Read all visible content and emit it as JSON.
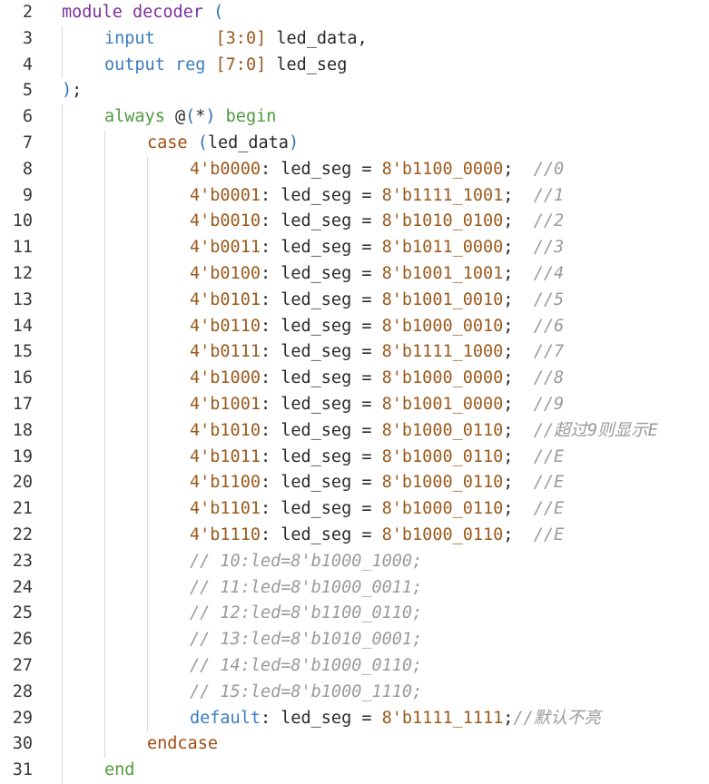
{
  "colors": {
    "background": "#ffffff",
    "line_number": "#3a3a3a",
    "module_keyword": "#7b2f9e",
    "port_keyword": "#3a7dbf",
    "always_keyword": "#4f9a3e",
    "control_keyword": "#a04a10",
    "number_literal": "#9a5a1d",
    "comment": "#9a9a9a",
    "indent_guide": "#d6d6d6"
  },
  "lines": [
    {
      "n": "2",
      "indent": 0,
      "tokens": [
        {
          "c": "kw",
          "t": "module"
        },
        {
          "c": "pl",
          "t": " "
        },
        {
          "c": "kw",
          "t": "decoder"
        },
        {
          "c": "pl",
          "t": " "
        },
        {
          "c": "br",
          "t": "("
        }
      ]
    },
    {
      "n": "3",
      "indent": 1,
      "tokens": [
        {
          "c": "kb",
          "t": "input"
        },
        {
          "c": "pl",
          "t": "      "
        },
        {
          "c": "num",
          "t": "[3:0]"
        },
        {
          "c": "pl",
          "t": " led_data,"
        }
      ]
    },
    {
      "n": "4",
      "indent": 1,
      "tokens": [
        {
          "c": "kb",
          "t": "output reg"
        },
        {
          "c": "pl",
          "t": " "
        },
        {
          "c": "num",
          "t": "[7:0]"
        },
        {
          "c": "pl",
          "t": " led_seg"
        }
      ]
    },
    {
      "n": "5",
      "indent": 0,
      "tokens": [
        {
          "c": "br",
          "t": ")"
        },
        {
          "c": "pl",
          "t": ";"
        }
      ]
    },
    {
      "n": "6",
      "indent": 1,
      "tokens": [
        {
          "c": "kg",
          "t": "always"
        },
        {
          "c": "pl",
          "t": " @"
        },
        {
          "c": "br",
          "t": "("
        },
        {
          "c": "pl",
          "t": "*"
        },
        {
          "c": "br",
          "t": ")"
        },
        {
          "c": "pl",
          "t": " "
        },
        {
          "c": "kg",
          "t": "begin"
        }
      ]
    },
    {
      "n": "7",
      "indent": 2,
      "tokens": [
        {
          "c": "kr",
          "t": "case"
        },
        {
          "c": "pl",
          "t": " "
        },
        {
          "c": "br",
          "t": "("
        },
        {
          "c": "pl",
          "t": "led_data"
        },
        {
          "c": "br",
          "t": ")"
        }
      ]
    },
    {
      "n": "8",
      "indent": 3,
      "tokens": [
        {
          "c": "num",
          "t": "4'b0000"
        },
        {
          "c": "pl",
          "t": ": led_seg = "
        },
        {
          "c": "num",
          "t": "8'b1100_0000"
        },
        {
          "c": "pl",
          "t": ";  "
        },
        {
          "c": "cm",
          "t": "//0"
        }
      ]
    },
    {
      "n": "9",
      "indent": 3,
      "tokens": [
        {
          "c": "num",
          "t": "4'b0001"
        },
        {
          "c": "pl",
          "t": ": led_seg = "
        },
        {
          "c": "num",
          "t": "8'b1111_1001"
        },
        {
          "c": "pl",
          "t": ";  "
        },
        {
          "c": "cm",
          "t": "//1"
        }
      ]
    },
    {
      "n": "10",
      "indent": 3,
      "tokens": [
        {
          "c": "num",
          "t": "4'b0010"
        },
        {
          "c": "pl",
          "t": ": led_seg = "
        },
        {
          "c": "num",
          "t": "8'b1010_0100"
        },
        {
          "c": "pl",
          "t": ";  "
        },
        {
          "c": "cm",
          "t": "//2"
        }
      ]
    },
    {
      "n": "11",
      "indent": 3,
      "tokens": [
        {
          "c": "num",
          "t": "4'b0011"
        },
        {
          "c": "pl",
          "t": ": led_seg = "
        },
        {
          "c": "num",
          "t": "8'b1011_0000"
        },
        {
          "c": "pl",
          "t": ";  "
        },
        {
          "c": "cm",
          "t": "//3"
        }
      ]
    },
    {
      "n": "12",
      "indent": 3,
      "tokens": [
        {
          "c": "num",
          "t": "4'b0100"
        },
        {
          "c": "pl",
          "t": ": led_seg = "
        },
        {
          "c": "num",
          "t": "8'b1001_1001"
        },
        {
          "c": "pl",
          "t": ";  "
        },
        {
          "c": "cm",
          "t": "//4"
        }
      ]
    },
    {
      "n": "13",
      "indent": 3,
      "tokens": [
        {
          "c": "num",
          "t": "4'b0101"
        },
        {
          "c": "pl",
          "t": ": led_seg = "
        },
        {
          "c": "num",
          "t": "8'b1001_0010"
        },
        {
          "c": "pl",
          "t": ";  "
        },
        {
          "c": "cm",
          "t": "//5"
        }
      ]
    },
    {
      "n": "14",
      "indent": 3,
      "tokens": [
        {
          "c": "num",
          "t": "4'b0110"
        },
        {
          "c": "pl",
          "t": ": led_seg = "
        },
        {
          "c": "num",
          "t": "8'b1000_0010"
        },
        {
          "c": "pl",
          "t": ";  "
        },
        {
          "c": "cm",
          "t": "//6"
        }
      ]
    },
    {
      "n": "15",
      "indent": 3,
      "tokens": [
        {
          "c": "num",
          "t": "4'b0111"
        },
        {
          "c": "pl",
          "t": ": led_seg = "
        },
        {
          "c": "num",
          "t": "8'b1111_1000"
        },
        {
          "c": "pl",
          "t": ";  "
        },
        {
          "c": "cm",
          "t": "//7"
        }
      ]
    },
    {
      "n": "16",
      "indent": 3,
      "tokens": [
        {
          "c": "num",
          "t": "4'b1000"
        },
        {
          "c": "pl",
          "t": ": led_seg = "
        },
        {
          "c": "num",
          "t": "8'b1000_0000"
        },
        {
          "c": "pl",
          "t": ";  "
        },
        {
          "c": "cm",
          "t": "//8"
        }
      ]
    },
    {
      "n": "17",
      "indent": 3,
      "tokens": [
        {
          "c": "num",
          "t": "4'b1001"
        },
        {
          "c": "pl",
          "t": ": led_seg = "
        },
        {
          "c": "num",
          "t": "8'b1001_0000"
        },
        {
          "c": "pl",
          "t": ";  "
        },
        {
          "c": "cm",
          "t": "//9"
        }
      ]
    },
    {
      "n": "18",
      "indent": 3,
      "tokens": [
        {
          "c": "num",
          "t": "4'b1010"
        },
        {
          "c": "pl",
          "t": ": led_seg = "
        },
        {
          "c": "num",
          "t": "8'b1000_0110"
        },
        {
          "c": "pl",
          "t": ";  "
        },
        {
          "c": "cm",
          "t": "//超过9则显示E"
        }
      ]
    },
    {
      "n": "19",
      "indent": 3,
      "tokens": [
        {
          "c": "num",
          "t": "4'b1011"
        },
        {
          "c": "pl",
          "t": ": led_seg = "
        },
        {
          "c": "num",
          "t": "8'b1000_0110"
        },
        {
          "c": "pl",
          "t": ";  "
        },
        {
          "c": "cm",
          "t": "//E"
        }
      ]
    },
    {
      "n": "20",
      "indent": 3,
      "tokens": [
        {
          "c": "num",
          "t": "4'b1100"
        },
        {
          "c": "pl",
          "t": ": led_seg = "
        },
        {
          "c": "num",
          "t": "8'b1000_0110"
        },
        {
          "c": "pl",
          "t": ";  "
        },
        {
          "c": "cm",
          "t": "//E"
        }
      ]
    },
    {
      "n": "21",
      "indent": 3,
      "tokens": [
        {
          "c": "num",
          "t": "4'b1101"
        },
        {
          "c": "pl",
          "t": ": led_seg = "
        },
        {
          "c": "num",
          "t": "8'b1000_0110"
        },
        {
          "c": "pl",
          "t": ";  "
        },
        {
          "c": "cm",
          "t": "//E"
        }
      ]
    },
    {
      "n": "22",
      "indent": 3,
      "tokens": [
        {
          "c": "num",
          "t": "4'b1110"
        },
        {
          "c": "pl",
          "t": ": led_seg = "
        },
        {
          "c": "num",
          "t": "8'b1000_0110"
        },
        {
          "c": "pl",
          "t": ";  "
        },
        {
          "c": "cm",
          "t": "//E"
        }
      ]
    },
    {
      "n": "23",
      "indent": 3,
      "tokens": [
        {
          "c": "cm",
          "t": "// 10:led=8'b1000_1000;"
        }
      ]
    },
    {
      "n": "24",
      "indent": 3,
      "tokens": [
        {
          "c": "cm",
          "t": "// 11:led=8'b1000_0011;"
        }
      ]
    },
    {
      "n": "25",
      "indent": 3,
      "tokens": [
        {
          "c": "cm",
          "t": "// 12:led=8'b1100_0110;"
        }
      ]
    },
    {
      "n": "26",
      "indent": 3,
      "tokens": [
        {
          "c": "cm",
          "t": "// 13:led=8'b1010_0001;"
        }
      ]
    },
    {
      "n": "27",
      "indent": 3,
      "tokens": [
        {
          "c": "cm",
          "t": "// 14:led=8'b1000_0110;"
        }
      ]
    },
    {
      "n": "28",
      "indent": 3,
      "tokens": [
        {
          "c": "cm",
          "t": "// 15:led=8'b1000_1110;"
        }
      ]
    },
    {
      "n": "29",
      "indent": 3,
      "tokens": [
        {
          "c": "kb",
          "t": "default"
        },
        {
          "c": "pl",
          "t": ": led_seg = "
        },
        {
          "c": "num",
          "t": "8'b1111_1111"
        },
        {
          "c": "pl",
          "t": ";"
        },
        {
          "c": "cm",
          "t": "//默认不亮"
        }
      ]
    },
    {
      "n": "30",
      "indent": 2,
      "tokens": [
        {
          "c": "kr",
          "t": "endcase"
        }
      ]
    },
    {
      "n": "31",
      "indent": 1,
      "tokens": [
        {
          "c": "kg",
          "t": "end"
        }
      ]
    }
  ]
}
